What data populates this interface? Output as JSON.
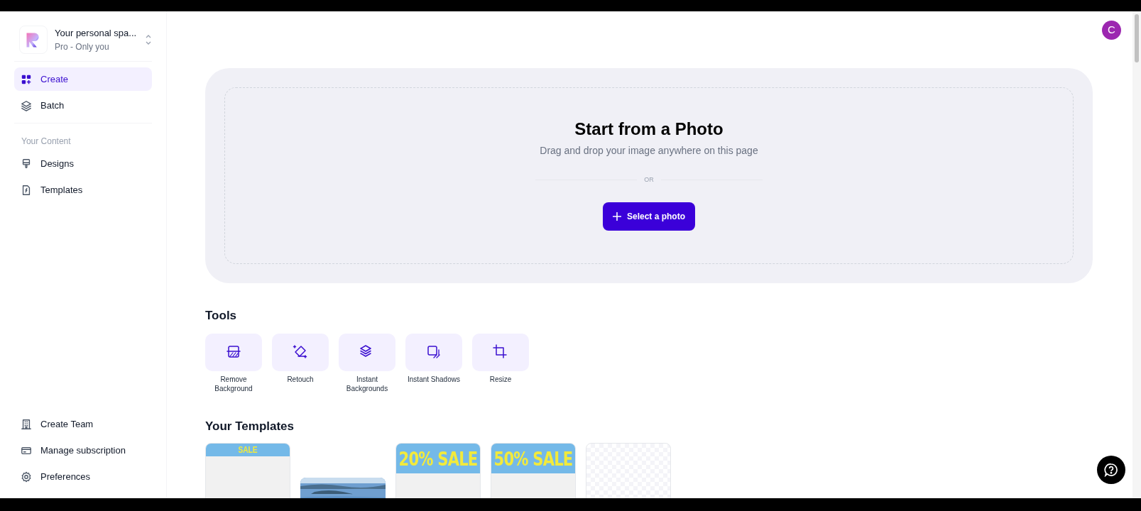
{
  "workspace": {
    "title": "Your personal spa...",
    "subtitle": "Pro - Only you"
  },
  "nav": [
    {
      "label": "Create",
      "selected": true
    },
    {
      "label": "Batch",
      "selected": false
    }
  ],
  "content_section": {
    "heading": "Your Content",
    "items": [
      {
        "label": "Designs",
        "selected": false
      },
      {
        "label": "Templates",
        "selected": false
      }
    ]
  },
  "footer_nav": [
    {
      "label": "Create Team"
    },
    {
      "label": "Manage subscription"
    },
    {
      "label": "Preferences"
    }
  ],
  "avatar": {
    "initial": "C"
  },
  "upload": {
    "title": "Start from a Photo",
    "subtitle": "Drag and drop your image anywhere on this page",
    "divider": "OR",
    "button": "Select a photo"
  },
  "tools": {
    "heading": "Tools",
    "items": [
      {
        "label": "Remove Background"
      },
      {
        "label": "Retouch"
      },
      {
        "label": "Instant Backgrounds"
      },
      {
        "label": "Instant Shadows"
      },
      {
        "label": "Resize"
      }
    ]
  },
  "templates": {
    "heading": "Your Templates",
    "items": [
      {
        "kind": "strip",
        "text": "SALE"
      },
      {
        "kind": "picture"
      },
      {
        "kind": "banner",
        "text": "20% SALE"
      },
      {
        "kind": "banner",
        "text": "50% SALE"
      },
      {
        "kind": "blank"
      }
    ]
  }
}
